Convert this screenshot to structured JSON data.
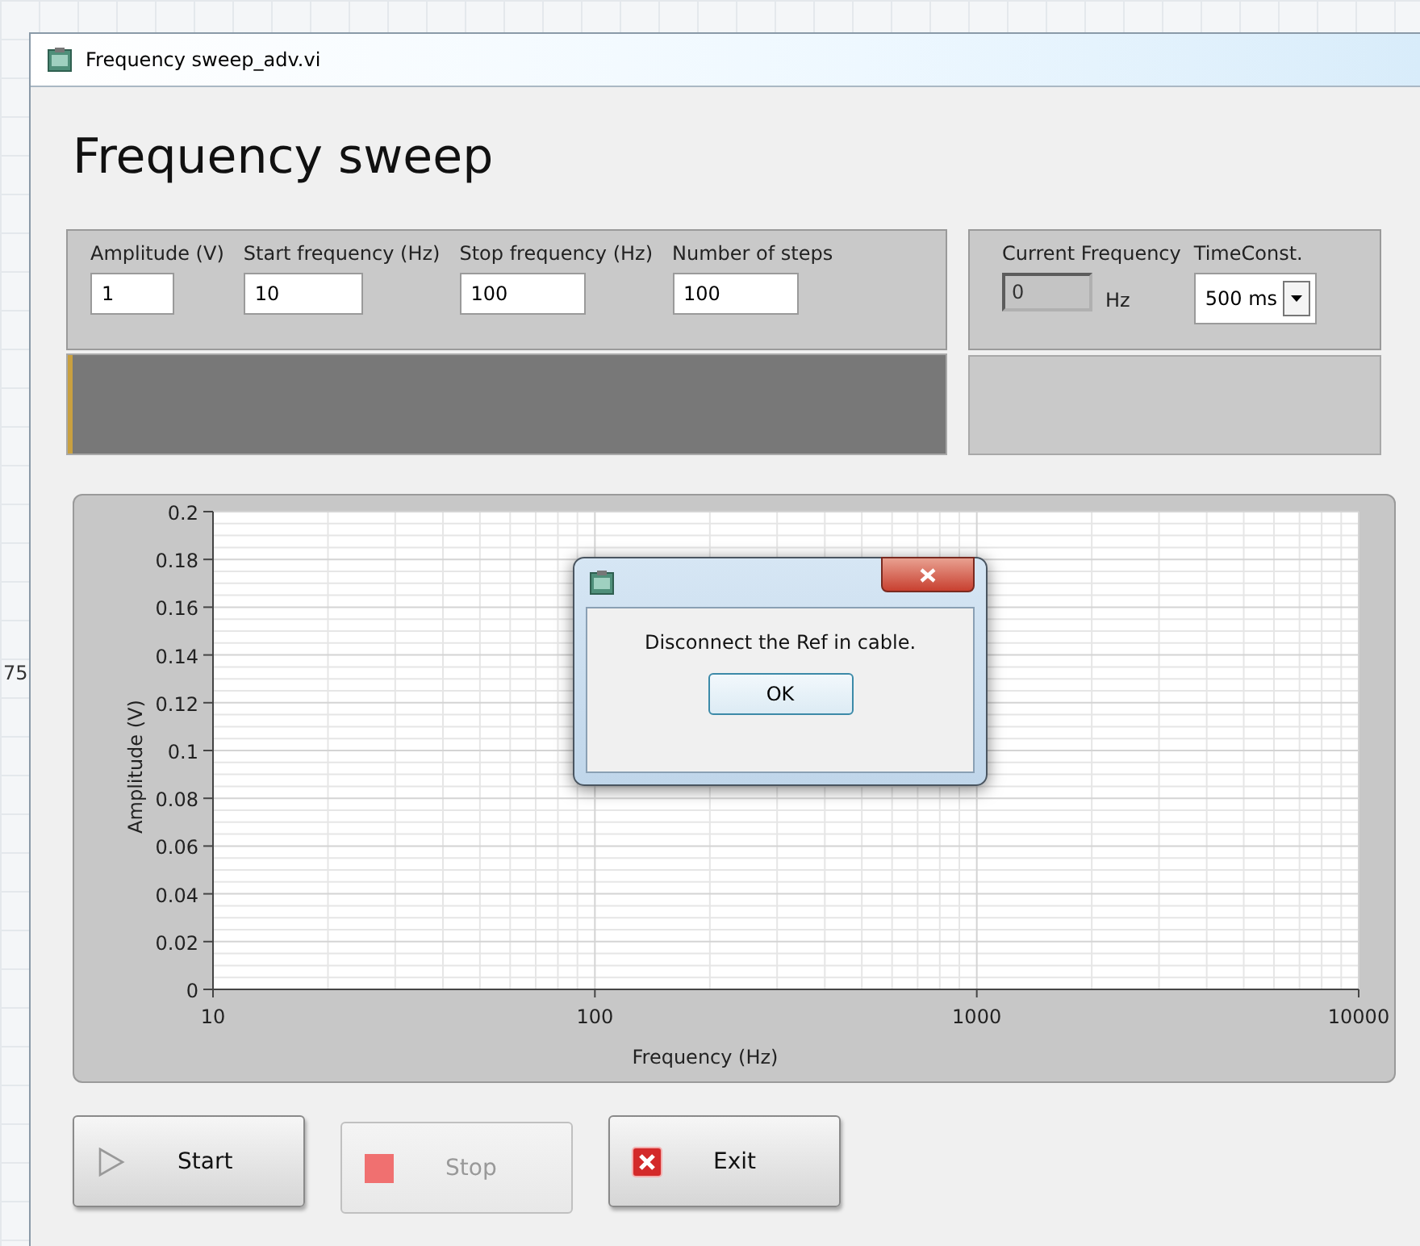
{
  "background": {
    "fragment": "75"
  },
  "window": {
    "title": "Frequency sweep_adv.vi"
  },
  "heading": "Frequency sweep",
  "inputs": [
    {
      "label": "Amplitude (V)",
      "value": "1"
    },
    {
      "label": "Start frequency (Hz)",
      "value": "10"
    },
    {
      "label": "Stop frequency (Hz)",
      "value": "100"
    },
    {
      "label": "Number of steps",
      "value": "100"
    }
  ],
  "current_frequency": {
    "label": "Current Frequency",
    "value": "0",
    "unit": "Hz"
  },
  "time_constant": {
    "label": "TimeConst.",
    "value": "500 ms"
  },
  "progress": {
    "level": 0.005
  },
  "graph": {
    "chart_data": {
      "type": "line",
      "xlabel": "Frequency (Hz)",
      "ylabel": "Amplitude (V)",
      "categories": [
        "10",
        "100",
        "1000",
        "10000"
      ],
      "ylim": [
        0,
        0.2
      ],
      "grid": true,
      "yticks": [
        0,
        0.02,
        0.04,
        0.06,
        0.08,
        0.1,
        0.12,
        0.14,
        0.16,
        0.18,
        0.2
      ]
    }
  },
  "buttons": [
    {
      "label": "Start",
      "kind": "start",
      "disabled": false
    },
    {
      "label": "Stop",
      "kind": "stop",
      "disabled": true
    },
    {
      "label": "Exit",
      "kind": "exit",
      "disabled": false
    }
  ],
  "dialog": {
    "message": "Disconnect the Ref in cable.",
    "button": "OK"
  }
}
